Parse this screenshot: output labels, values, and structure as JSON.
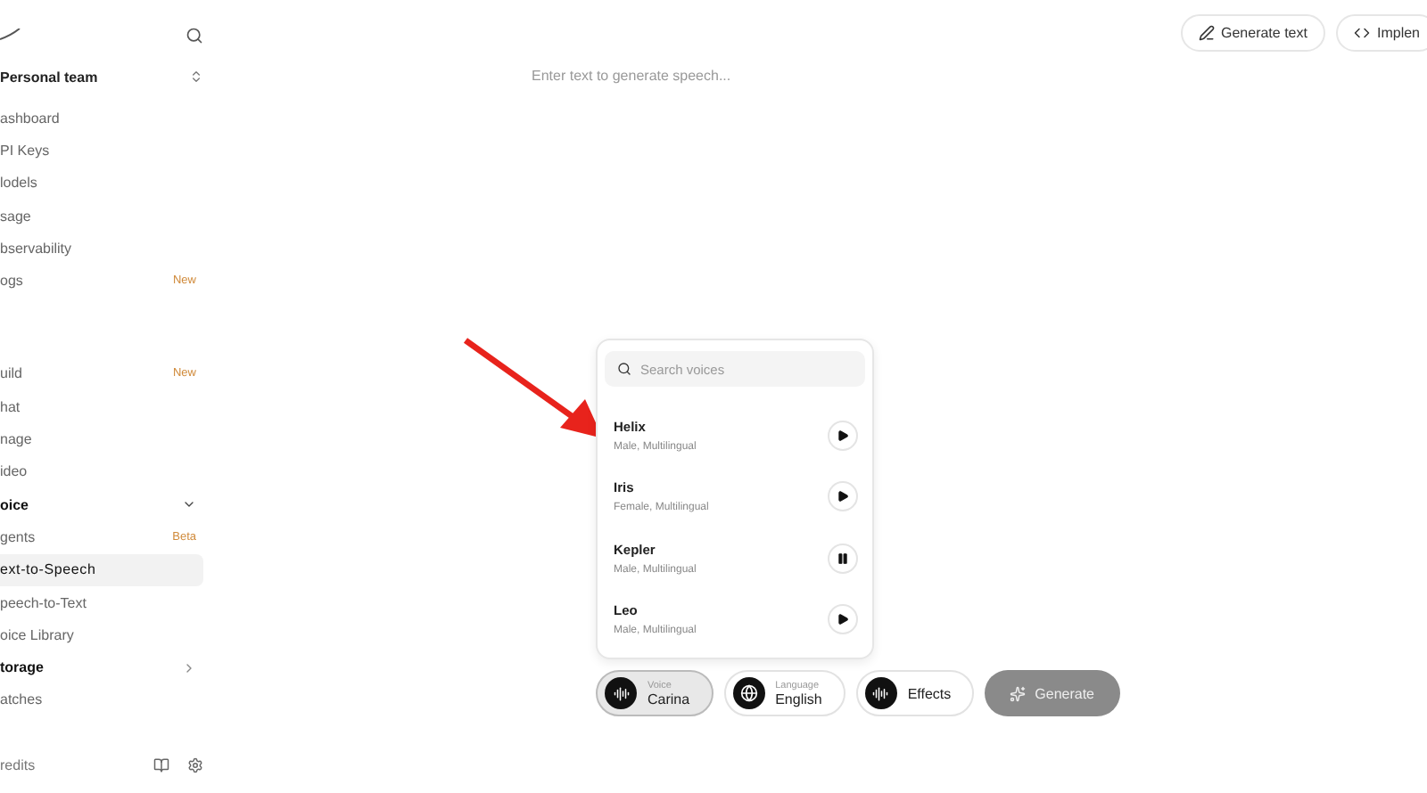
{
  "sidebar": {
    "team": "Personal team",
    "sections": [
      {
        "items": [
          {
            "label": "ashboard",
            "kind": "link",
            "selected": false
          },
          {
            "label": "PI Keys",
            "kind": "link",
            "selected": false
          },
          {
            "label": "lodels",
            "kind": "link",
            "selected": false
          },
          {
            "label": "sage",
            "kind": "link",
            "selected": false
          },
          {
            "label": "bservability",
            "kind": "link",
            "selected": false
          },
          {
            "label": "ogs",
            "kind": "link",
            "selected": false,
            "badge": "New"
          }
        ]
      },
      {
        "items": [
          {
            "label": "uild",
            "kind": "link",
            "selected": false,
            "badge": "New"
          },
          {
            "label": "hat",
            "kind": "link",
            "selected": false
          },
          {
            "label": "nage",
            "kind": "link",
            "selected": false
          },
          {
            "label": "ideo",
            "kind": "link",
            "selected": false
          },
          {
            "label": "oice",
            "kind": "group",
            "expanded": true
          },
          {
            "label": "gents",
            "kind": "link",
            "selected": false,
            "badge": "Beta"
          },
          {
            "label": "ext-to-Speech",
            "kind": "link",
            "selected": true
          },
          {
            "label": "peech-to-Text",
            "kind": "link",
            "selected": false
          },
          {
            "label": "oice Library",
            "kind": "link",
            "selected": false
          },
          {
            "label": "torage",
            "kind": "group",
            "expanded": false
          },
          {
            "label": "atches",
            "kind": "link",
            "selected": false
          }
        ]
      }
    ],
    "footer": "redits"
  },
  "toolbar": {
    "buttons": [
      {
        "label": "Generate text",
        "kind": "pen"
      },
      {
        "label": "Implen",
        "kind": "code"
      }
    ]
  },
  "editor": {
    "placeholder": "Enter text to generate speech..."
  },
  "voice_picker": {
    "search": {
      "placeholder": "Search voices"
    },
    "voices": [
      {
        "name": "Helix",
        "description": "Male, Multilingual",
        "playing": false
      },
      {
        "name": "Iris",
        "description": "Female, Multilingual",
        "playing": false
      },
      {
        "name": "Kepler",
        "description": "Male, Multilingual",
        "playing": true
      },
      {
        "name": "Leo",
        "description": "Male, Multilingual",
        "playing": false
      }
    ]
  },
  "controls": {
    "voice": {
      "label": "Voice",
      "value": "Carina",
      "selected": true
    },
    "language": {
      "label": "Language",
      "value": "English",
      "selected": false
    },
    "effects": {
      "label": "Effects",
      "selected": false
    },
    "generate": {
      "label": "Generate",
      "disabled": true
    }
  }
}
